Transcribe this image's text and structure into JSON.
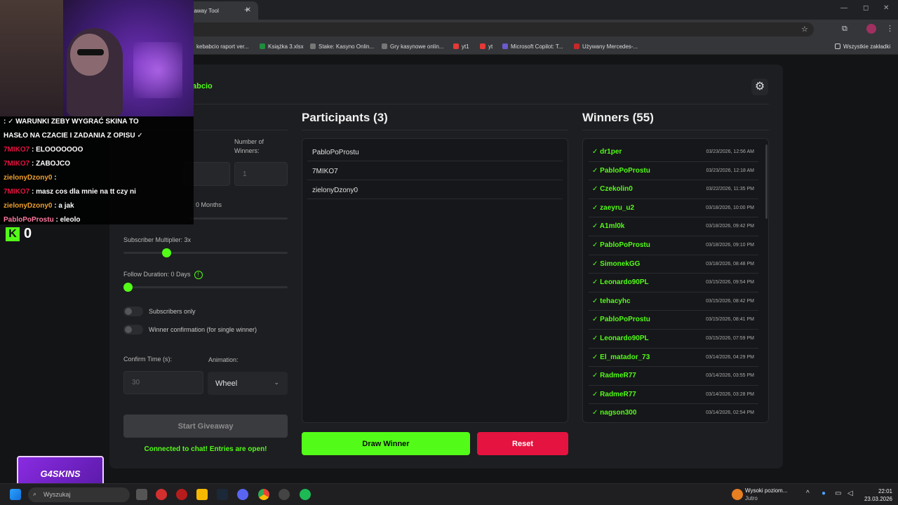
{
  "browser": {
    "tab_title": "eaway Tool",
    "bookmarks": [
      {
        "label": "kebabcio raport ver...",
        "color": "#2e7d32"
      },
      {
        "label": "Książka 3.xlsx",
        "color": "#1e8e3e"
      },
      {
        "label": "Stake: Kasyno Onlin...",
        "color": "#777"
      },
      {
        "label": "Gry kasynowe onlin...",
        "color": "#777"
      },
      {
        "label": "yt1",
        "color": "#e53935"
      },
      {
        "label": "yt",
        "color": "#e53935"
      },
      {
        "label": "Microsoft Copilot: T...",
        "color": "#6a5acd"
      },
      {
        "label": "Używany Mercedes-...",
        "color": "#c62828"
      }
    ],
    "all_bookmarks": "Wszystkie zakładki"
  },
  "app": {
    "name": "abcio",
    "settings_icon": "gear-icon"
  },
  "settings": {
    "num_winners_label": "Number of Winners:",
    "num_winners_value": "1",
    "sub_duration_fragment": ": 0 Months",
    "sub_multiplier_label": "Subscriber Multiplier: 3x",
    "sub_multiplier_level": 0.25,
    "follow_duration_label": "Follow Duration:  0  Days",
    "follow_duration_level": 0.0,
    "subscribers_only": "Subscribers only",
    "winner_confirmation": "Winner confirmation (for single winner)",
    "confirm_time_label": "Confirm Time (s):",
    "confirm_time_placeholder": "30",
    "animation_label": "Animation:",
    "animation_value": "Wheel",
    "start_button": "Start Giveaway",
    "status": "Connected to chat! Entries are open!"
  },
  "participants": {
    "title": "Participants (3)",
    "list": [
      "PabloPoProstu",
      "7MIKO7",
      "zielonyDzony0"
    ],
    "draw_button": "Draw Winner",
    "reset_button": "Reset"
  },
  "winners": {
    "title": "Winners (55)",
    "list": [
      {
        "name": "✓ dr1per",
        "time": "03/23/2026, 12:56 AM"
      },
      {
        "name": "✓ PabloPoProstu",
        "time": "03/23/2026, 12:18 AM"
      },
      {
        "name": "✓ Czekolin0",
        "time": "03/22/2026, 11:35 PM"
      },
      {
        "name": "✓ zaeyru_u2",
        "time": "03/18/2026, 10:00 PM"
      },
      {
        "name": "✓ A1ml0k",
        "time": "03/18/2026, 09:42 PM"
      },
      {
        "name": "✓ PabloPoProstu",
        "time": "03/18/2026, 09:10 PM"
      },
      {
        "name": "✓ SimonekGG",
        "time": "03/18/2026, 08:48 PM"
      },
      {
        "name": "✓ Leonardo90PL",
        "time": "03/15/2026, 09:54 PM"
      },
      {
        "name": "✓ tehacyhc",
        "time": "03/15/2026, 08:42 PM"
      },
      {
        "name": "✓ PabloPoProstu",
        "time": "03/15/2026, 08:41 PM"
      },
      {
        "name": "✓ Leonardo90PL",
        "time": "03/15/2026, 07:59 PM"
      },
      {
        "name": "✓ El_matador_73",
        "time": "03/14/2026, 04:29 PM"
      },
      {
        "name": "✓ RadmeR77",
        "time": "03/14/2026, 03:55 PM"
      },
      {
        "name": "✓ RadmeR77",
        "time": "03/14/2026, 03:28 PM"
      },
      {
        "name": "✓ nagson300",
        "time": "03/14/2026, 02:54 PM"
      }
    ]
  },
  "stream": {
    "chat": [
      {
        "user": "",
        "text": ": ✓ WARUNKI ZEBY WYGRAĆ SKINA TO",
        "cls": ""
      },
      {
        "user": "",
        "text": "HASŁO NA CZACIE I ZADANIA Z OPISU ✓",
        "cls": ""
      },
      {
        "user": "7MIKO7",
        "text": " : ELOOOOOOO",
        "cls": "u"
      },
      {
        "user": "7MIKO7",
        "text": " : ZABOJCO",
        "cls": "u"
      },
      {
        "user": "zielonyDzony0",
        "text": " : ",
        "cls": "u2"
      },
      {
        "user": "7MIKO7",
        "text": " : masz cos dla mnie na tt czy ni",
        "cls": "u"
      },
      {
        "user": "zielonyDzony0",
        "text": " : a jak",
        "cls": "u2"
      },
      {
        "user": "PabloPoProstu",
        "text": " : eleolo",
        "cls": "u3"
      }
    ],
    "kick_count": "0",
    "sponsor": "G4SKINS"
  },
  "taskbar": {
    "search_placeholder": "Wyszukaj",
    "weather_title": "Wysoki poziom...",
    "weather_sub": "Jutro",
    "time": "22:01",
    "date": "23.03.2026"
  }
}
